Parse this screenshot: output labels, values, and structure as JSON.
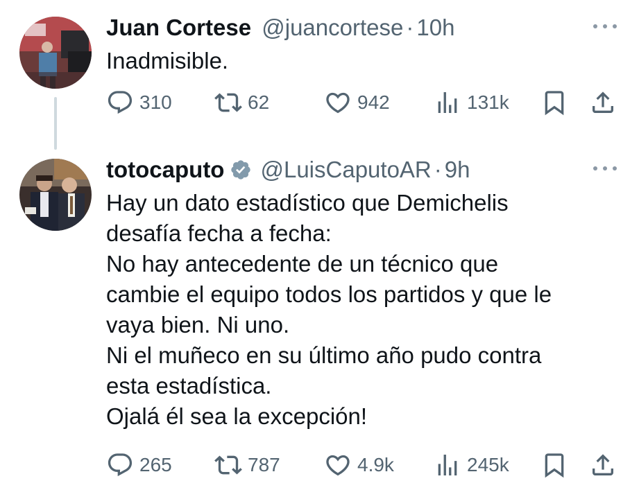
{
  "tweets": [
    {
      "display_name": "Juan Cortese",
      "handle": "@juancortese",
      "separator": "·",
      "time": "10h",
      "lines": [
        "Inadmisible."
      ],
      "stats": {
        "replies": "310",
        "reposts": "62",
        "likes": "942",
        "views": "131k"
      },
      "verified": false
    },
    {
      "display_name": "totocaputo",
      "handle": "@LuisCaputoAR",
      "separator": "·",
      "time": "9h",
      "lines": [
        "Hay un dato estadístico que Demichelis",
        "desafía fecha a fecha:",
        "No hay antecedente de un técnico que",
        "cambie el equipo todos los partidos y que le",
        "vaya bien. Ni uno.",
        "Ni el muñeco en su último año pudo contra",
        "esta estadística.",
        "Ojalá él sea la excepción!"
      ],
      "stats": {
        "replies": "265",
        "reposts": "787",
        "likes": "4.9k",
        "views": "245k"
      },
      "verified": true
    }
  ],
  "colors": {
    "text": "#0f1419",
    "secondary": "#536471",
    "thread_line": "#cfd9de",
    "verified": "#829aab"
  },
  "icons": [
    "reply-icon",
    "repost-icon",
    "like-icon",
    "views-icon",
    "bookmark-icon",
    "share-icon",
    "more-icon",
    "verified-icon"
  ]
}
